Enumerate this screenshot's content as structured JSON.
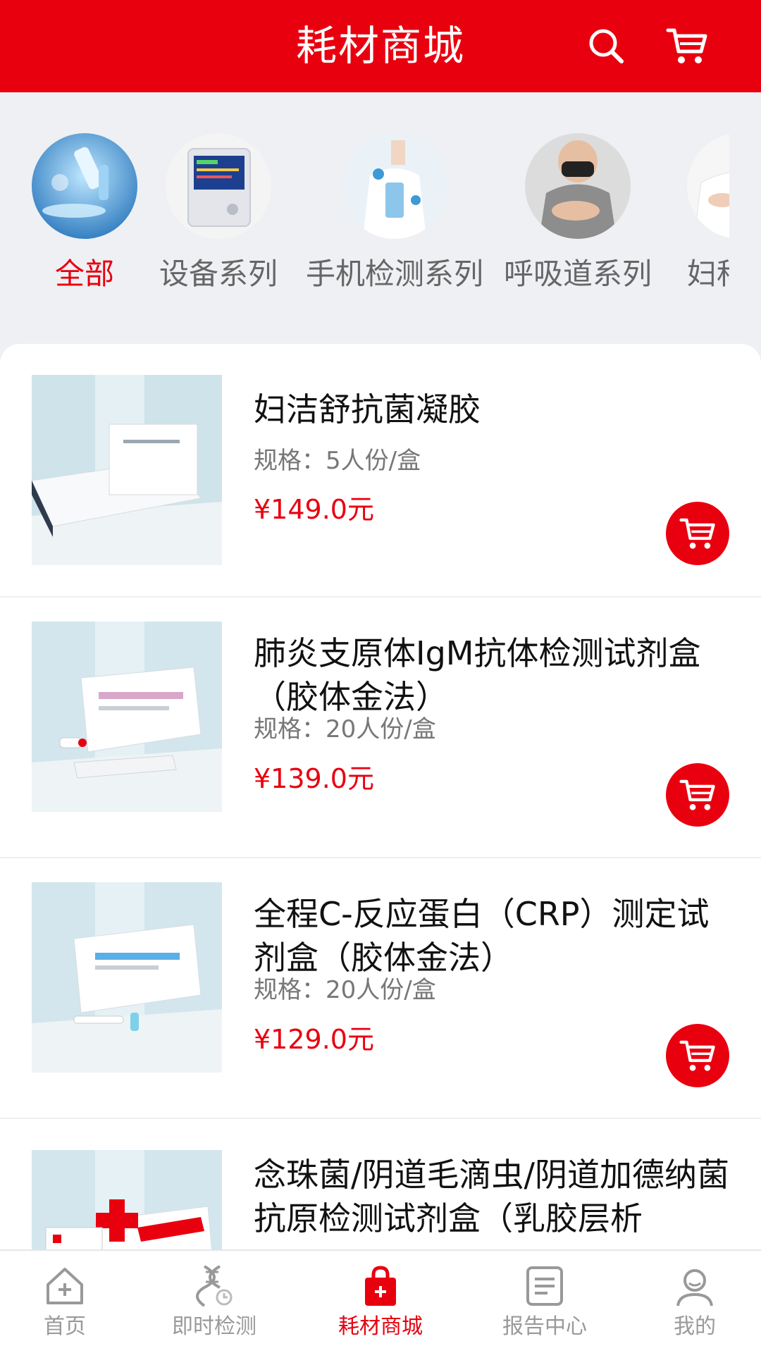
{
  "header": {
    "title": "耗材商城",
    "search_icon": "search-icon",
    "cart_icon": "cart-icon"
  },
  "categories": [
    {
      "label": "全部",
      "active": true,
      "icon": "microscope-image"
    },
    {
      "label": "设备系列",
      "active": false,
      "icon": "analyzer-device-image"
    },
    {
      "label": "手机检测系列",
      "active": false,
      "icon": "doctor-phone-image"
    },
    {
      "label": "呼吸道系列",
      "active": false,
      "icon": "coughing-person-image"
    },
    {
      "label": "妇科",
      "active": false,
      "icon": "woman-image"
    }
  ],
  "products": [
    {
      "name": "妇洁舒抗菌凝胶",
      "spec": "规格：5人份/盒",
      "price": "¥149.0元"
    },
    {
      "name": "肺炎支原体IgM抗体检测试剂盒（胶体金法）",
      "spec": "规格：20人份/盒",
      "price": "¥139.0元"
    },
    {
      "name": "全程C-反应蛋白（CRP）测定试剂盒（胶体金法）",
      "spec": "规格：20人份/盒",
      "price": "¥129.0元"
    },
    {
      "name": "念珠菌/阴道毛滴虫/阴道加德纳菌抗原检测试剂盒（乳胶层析",
      "spec": "",
      "price": ""
    }
  ],
  "bottom_nav": [
    {
      "label": "首页",
      "icon": "home-icon",
      "active": false
    },
    {
      "label": "即时检测",
      "icon": "dna-icon",
      "active": false
    },
    {
      "label": "耗材商城",
      "icon": "shopping-bag-icon",
      "active": true
    },
    {
      "label": "报告中心",
      "icon": "report-icon",
      "active": false
    },
    {
      "label": "我的",
      "icon": "user-icon",
      "active": false
    }
  ],
  "colors": {
    "brand_red": "#e8000f",
    "page_bg": "#eef0f3"
  }
}
